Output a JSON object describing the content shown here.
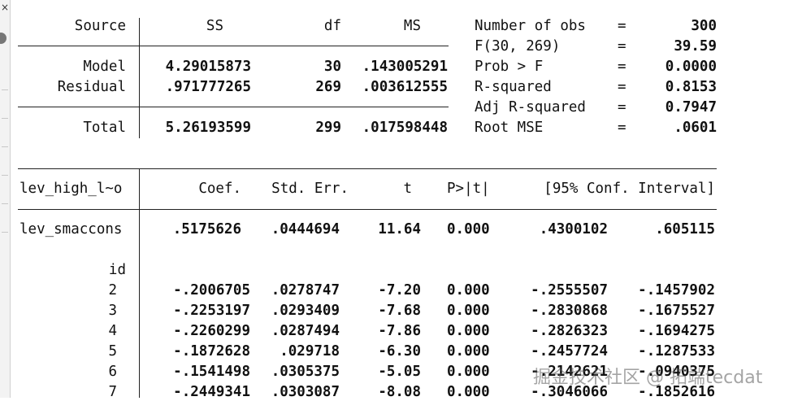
{
  "anova": {
    "headers": [
      "Source",
      "SS",
      "df",
      "MS"
    ],
    "rows": [
      {
        "source": "Model",
        "ss": "4.29015873",
        "df": "30",
        "ms": ".143005291"
      },
      {
        "source": "Residual",
        "ss": ".971777265",
        "df": "269",
        "ms": ".003612555"
      },
      {
        "source": "Total",
        "ss": "5.26193599",
        "df": "299",
        "ms": ".017598448"
      }
    ]
  },
  "stats": [
    {
      "label": "Number of obs",
      "eq": "=",
      "value": "300"
    },
    {
      "label": "F(30, 269)",
      "eq": "=",
      "value": "39.59"
    },
    {
      "label": "Prob > F",
      "eq": "=",
      "value": "0.0000"
    },
    {
      "label": "R-squared",
      "eq": "=",
      "value": "0.8153"
    },
    {
      "label": "Adj R-squared",
      "eq": "=",
      "value": "0.7947"
    },
    {
      "label": "Root MSE",
      "eq": "=",
      "value": ".0601"
    }
  ],
  "coef": {
    "depvar": "lev_high_l~o",
    "headers": [
      "Coef.",
      "Std. Err.",
      "t",
      "P>|t|",
      "[95% Conf. Interval]"
    ],
    "main_row": {
      "name": "lev_smaccons",
      "coef": ".5175626",
      "se": ".0444694",
      "t": "11.64",
      "p": "0.000",
      "lo": ".4300102",
      "hi": ".605115"
    },
    "factor_label": "id",
    "factor_rows": [
      {
        "name": "2",
        "coef": "-.2006705",
        "se": ".0278747",
        "t": "-7.20",
        "p": "0.000",
        "lo": "-.2555507",
        "hi": "-.1457902"
      },
      {
        "name": "3",
        "coef": "-.2253197",
        "se": ".0293409",
        "t": "-7.68",
        "p": "0.000",
        "lo": "-.2830868",
        "hi": "-.1675527"
      },
      {
        "name": "4",
        "coef": "-.2260299",
        "se": ".0287494",
        "t": "-7.86",
        "p": "0.000",
        "lo": "-.2826323",
        "hi": "-.1694275"
      },
      {
        "name": "5",
        "coef": "-.1872628",
        "se": ".029718",
        "t": "-6.30",
        "p": "0.000",
        "lo": "-.2457724",
        "hi": "-.1287533"
      },
      {
        "name": "6",
        "coef": "-.1541498",
        "se": ".0305375",
        "t": "-5.05",
        "p": "0.000",
        "lo": "-.2142621",
        "hi": "-.0940375"
      },
      {
        "name": "7",
        "coef": "-.2449341",
        "se": ".0303087",
        "t": "-8.08",
        "p": "0.000",
        "lo": "-.3046066",
        "hi": "-.1852616"
      }
    ]
  },
  "gutter": {
    "close_glyph": "×"
  },
  "watermark": "掘金技术社区 @ 拓端tecdat"
}
